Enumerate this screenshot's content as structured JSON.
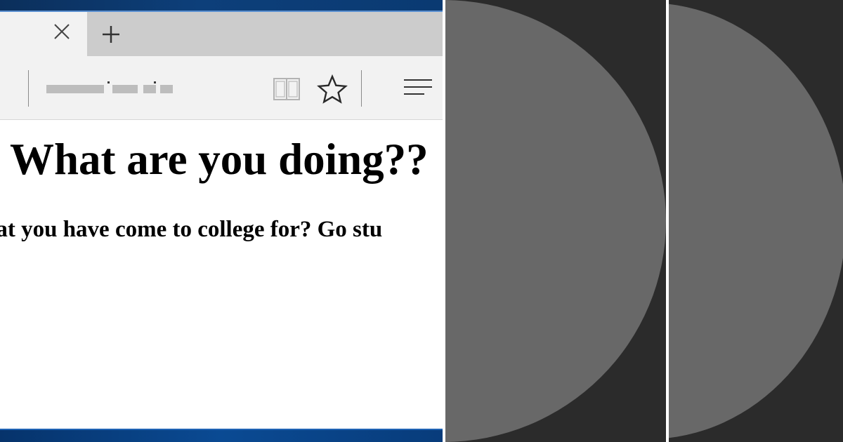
{
  "colors": {
    "page_background": "#ffffff",
    "tab_strip": "#cccccc",
    "toolbar": "#f2f2f2",
    "icon_gray": "#3a3a3a",
    "desktop_blue": "#0d3f7a",
    "panel_dark": "#2b2b2b",
    "panel_shape": "#686868"
  },
  "browser": {
    "tab": {
      "close_icon": "close-icon"
    },
    "new_tab_icon": "plus-icon",
    "toolbar": {
      "reading_view_icon": "book-icon",
      "favorites_icon": "star-icon",
      "hub_icon": "hamburger-icon",
      "address_blurred": true
    },
    "page": {
      "heading": "What are you doing??",
      "subheading": "hat you have come to college for? Go stu"
    }
  },
  "shape_panels": [
    {
      "icon": "half-circle-shape"
    },
    {
      "icon": "half-circle-shape"
    }
  ]
}
